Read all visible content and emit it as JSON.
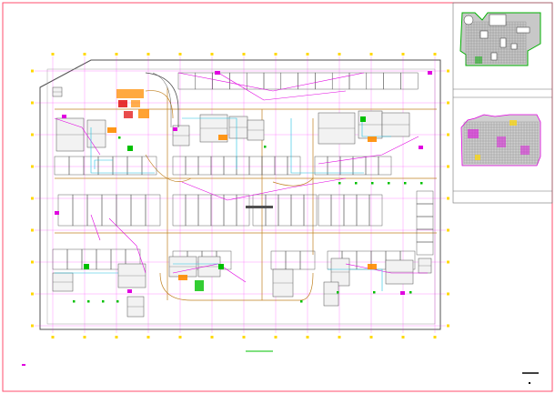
{
  "sheet": {
    "background": "#ffffff",
    "border_color": "#ff4d6d",
    "colors": {
      "grid_axis": "#ff00ff",
      "grid_marker": "#ffd800",
      "wall": "#505050",
      "room_fill": "#f2f2f2",
      "route_magenta": "#e000e0",
      "route_cyan": "#20c0e0",
      "drive_aisle": "#c08020",
      "highlight_green": "#00c000",
      "highlight_orange": "#ff8c00",
      "highlight_red": "#e00000",
      "keyplan_green": "#00b000",
      "keyplan_magenta": "#e000e0"
    }
  },
  "plan": {
    "name": "basement-floor-plan",
    "grid_columns": 12,
    "grid_rows": 8
  },
  "keyplan": {
    "upper": "site-key-plan",
    "lower": "floor-key-plan"
  },
  "title_block": {
    "scale_bar_icon": "scale-bar"
  }
}
